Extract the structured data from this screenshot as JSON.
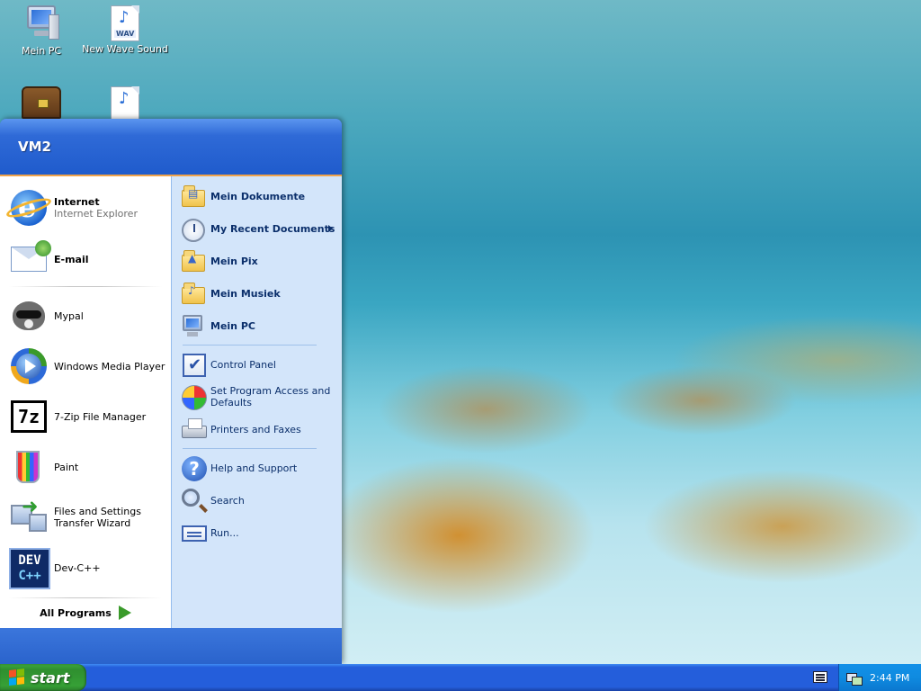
{
  "desktop": {
    "icons": [
      {
        "label": "Mein PC",
        "icon": "computer-icon"
      },
      {
        "label": "New Wave Sound",
        "icon": "wav-file-icon",
        "tag": "WAV"
      },
      {
        "label": "",
        "icon": "treasure-chest-icon"
      },
      {
        "label": "",
        "icon": "audio-file-icon"
      }
    ]
  },
  "start_menu": {
    "user_name": "VM2",
    "pinned": [
      {
        "title": "Internet",
        "subtitle": "Internet Explorer",
        "icon": "internet-explorer-icon"
      },
      {
        "title": "E-mail",
        "subtitle": "",
        "icon": "email-icon"
      }
    ],
    "recent": [
      {
        "title": "Mypal",
        "icon": "mypal-raccoon-icon"
      },
      {
        "title": "Windows Media Player",
        "icon": "media-player-icon"
      },
      {
        "title": "7-Zip File Manager",
        "icon": "7zip-icon",
        "badge": "7z"
      },
      {
        "title": "Paint",
        "icon": "paint-icon"
      },
      {
        "title_line1": "Files and Settings",
        "title_line2": "Transfer Wizard",
        "icon": "transfer-wizard-icon"
      },
      {
        "title": "Dev-C++",
        "icon": "devcpp-icon",
        "badge_top": "DEV",
        "badge_bottom": "C++"
      }
    ],
    "all_programs": "All Programs",
    "places": [
      {
        "title": "Mein Dokumente",
        "icon": "documents-folder-icon"
      },
      {
        "title": "My Recent Documents",
        "icon": "recent-documents-icon",
        "has_submenu": true
      },
      {
        "title": "Mein Pix",
        "icon": "pictures-folder-icon"
      },
      {
        "title": "Mein Musiek",
        "icon": "music-folder-icon"
      },
      {
        "title": "Mein PC",
        "icon": "computer-icon"
      }
    ],
    "system": [
      {
        "title": "Control Panel",
        "icon": "control-panel-icon"
      },
      {
        "title_line1": "Set Program Access and",
        "title_line2": "Defaults",
        "icon": "program-access-icon"
      },
      {
        "title": "Printers and Faxes",
        "icon": "printer-icon"
      }
    ],
    "help": [
      {
        "title": "Help and Support",
        "icon": "help-icon"
      },
      {
        "title": "Search",
        "icon": "search-icon"
      },
      {
        "title": "Run...",
        "icon": "run-icon"
      }
    ]
  },
  "taskbar": {
    "start_label": "start",
    "clock": "2:44 PM"
  }
}
